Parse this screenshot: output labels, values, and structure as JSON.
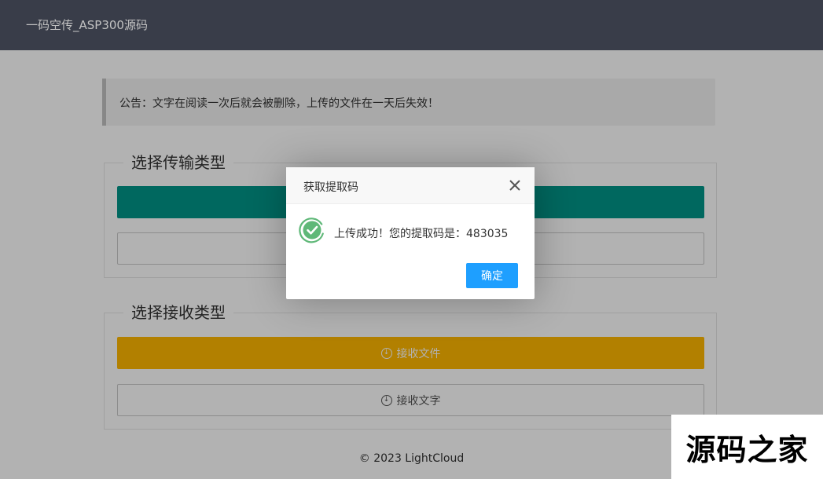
{
  "header": {
    "brand": "一码空传_ASP300源码"
  },
  "notice": {
    "text": "公告：文字在阅读一次后就会被删除，上传的文件在一天后失效！"
  },
  "send_section": {
    "title": "选择传输类型",
    "primary_label": "",
    "secondary_label": ""
  },
  "receive_section": {
    "title": "选择接收类型",
    "file_label": "接收文件",
    "text_label": "接收文字",
    "file_icon": "download-circle-icon",
    "text_icon": "download-circle-icon"
  },
  "footer": {
    "copyright": "© 2023 LightCloud"
  },
  "dialog": {
    "title": "获取提取码",
    "message": "上传成功！您的提取码是：483035",
    "confirm_label": "确定",
    "icon": "success-check-icon",
    "close_icon": "close-icon"
  },
  "watermark": {
    "text": "源码之家"
  },
  "colors": {
    "header_bg": "#393d49",
    "teal": "#009688",
    "orange": "#ffb800",
    "confirm_blue": "#1e9fff",
    "success_green": "#5fb878"
  }
}
